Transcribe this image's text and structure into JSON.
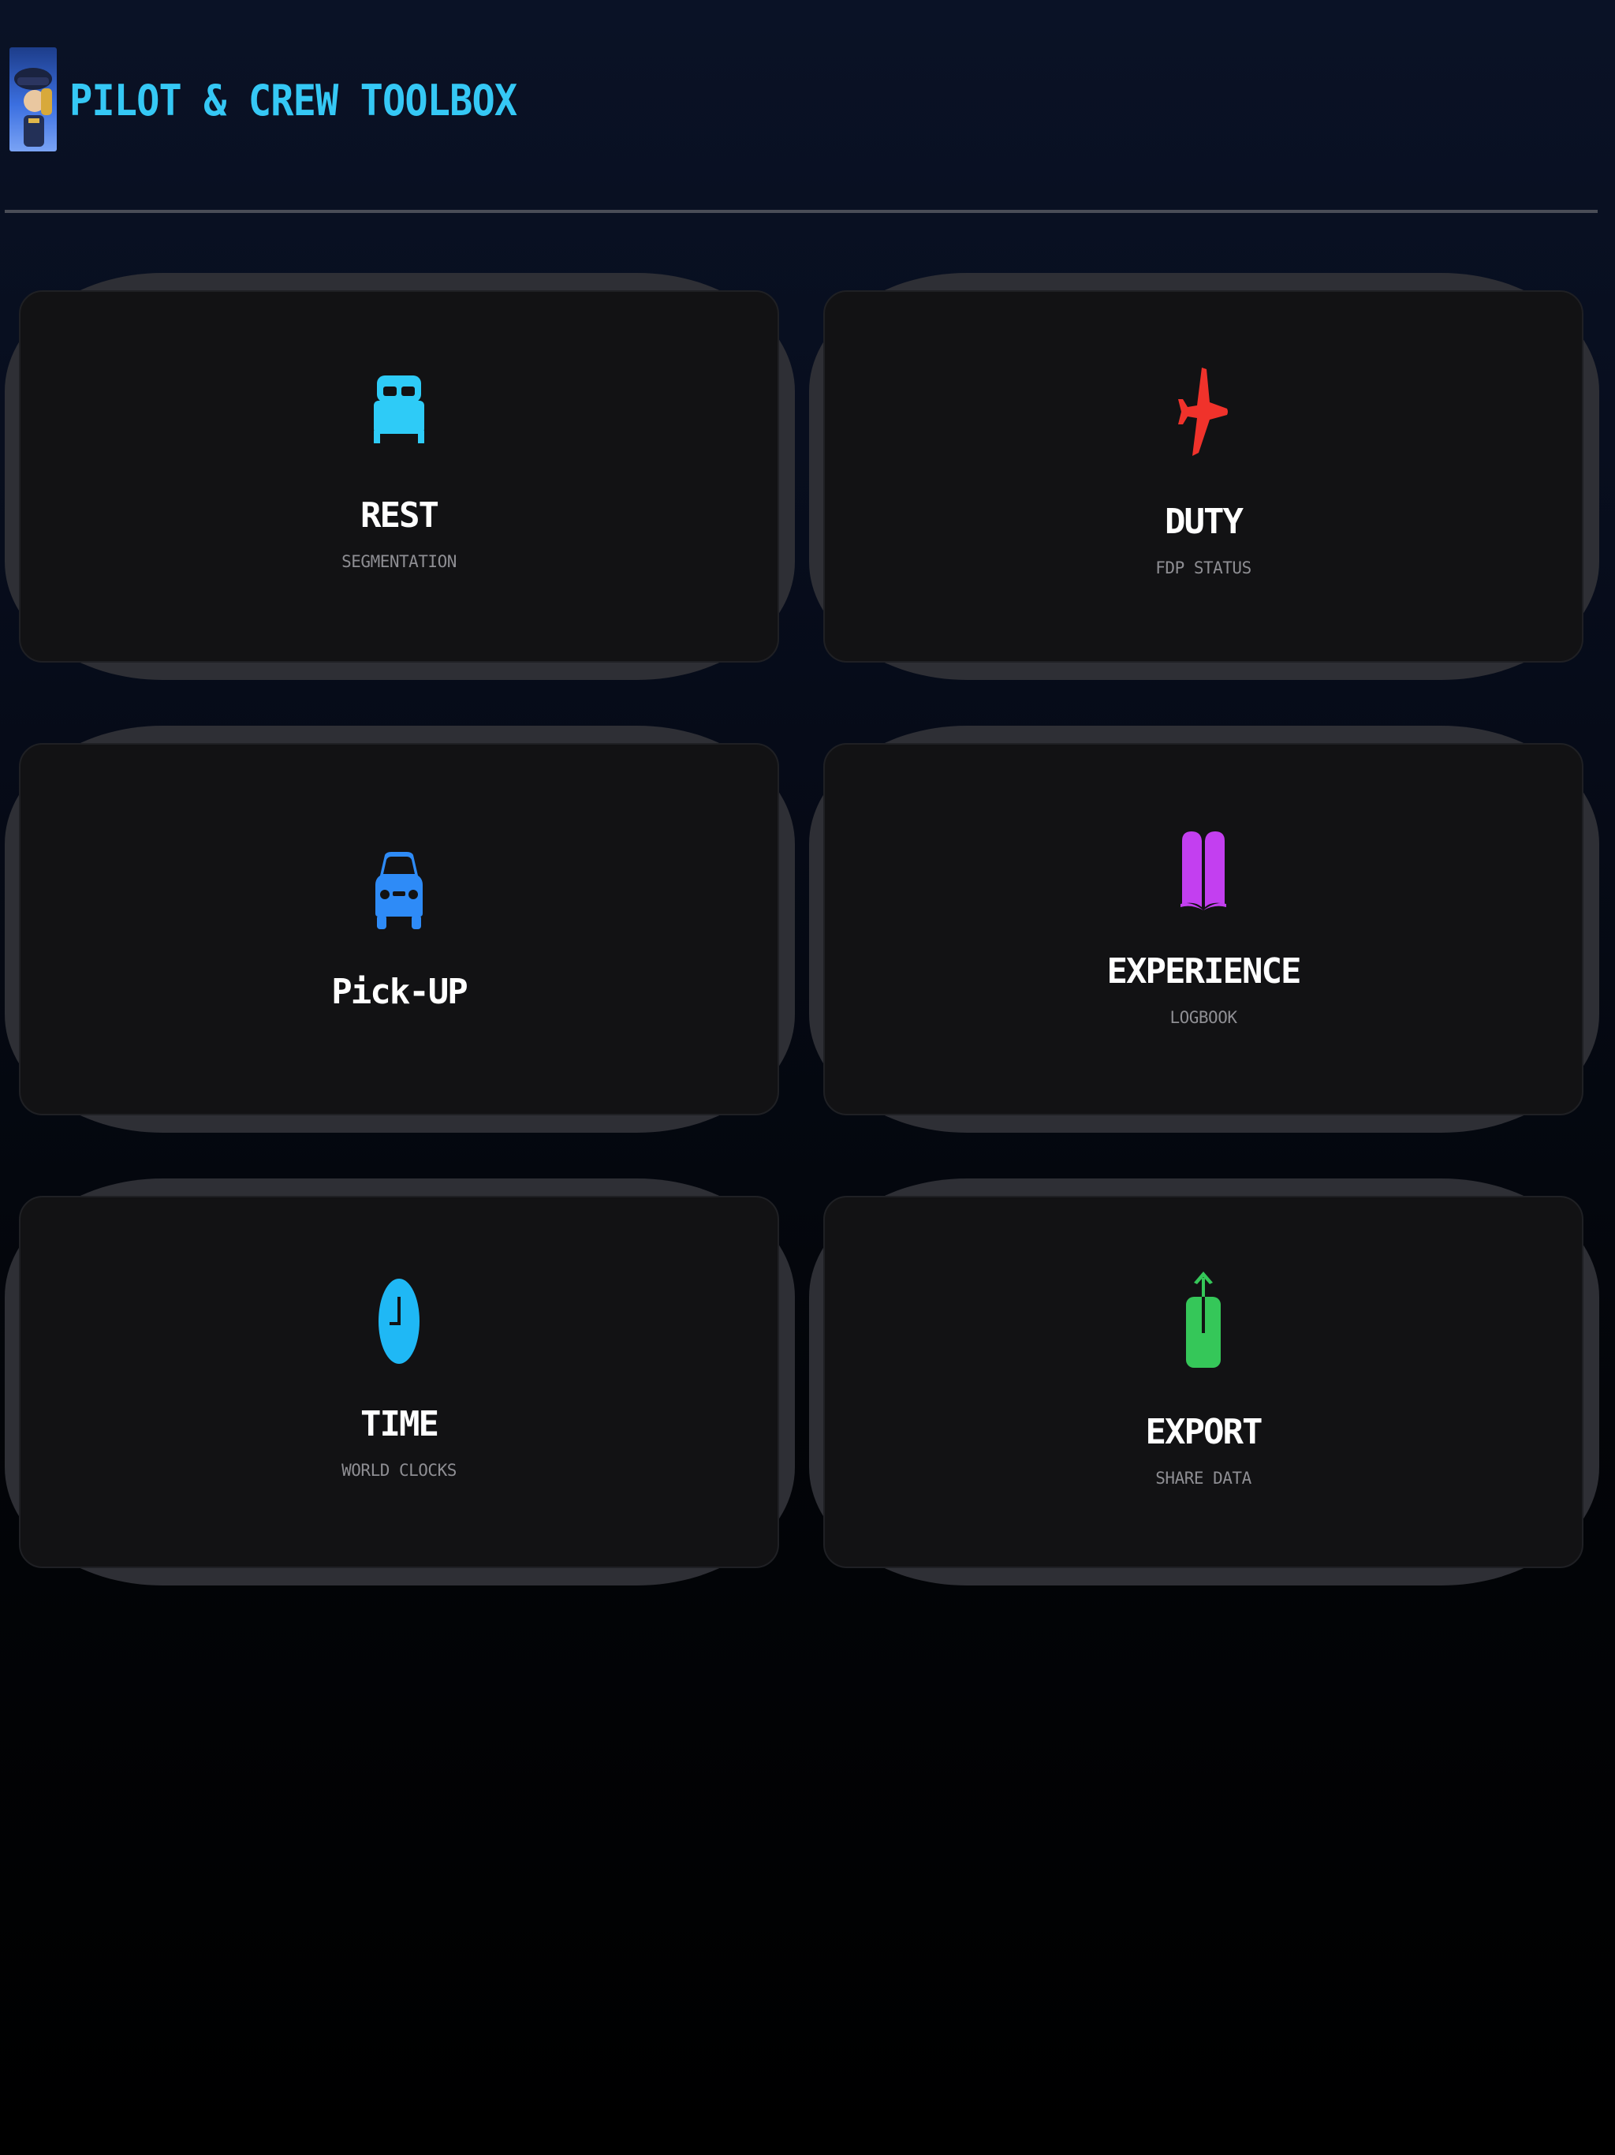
{
  "app": {
    "title": "PILOT & CREW TOOLBOX",
    "logo_icon": "pilot-avatar-icon"
  },
  "colors": {
    "title": "#35c8f5",
    "rest": "#2ecbf7",
    "duty": "#f0322b",
    "pickup": "#2e8bf7",
    "experience": "#c33ff0",
    "time": "#1fb8f5",
    "export": "#35c759"
  },
  "tiles": [
    {
      "id": "rest",
      "label": "REST",
      "sublabel": "SEGMENTATION",
      "icon": "bed-icon"
    },
    {
      "id": "duty",
      "label": "DUTY",
      "sublabel": "FDP STATUS",
      "icon": "airplane-icon"
    },
    {
      "id": "pickup",
      "label": "Pick-UP",
      "sublabel": "",
      "icon": "car-icon"
    },
    {
      "id": "experience",
      "label": "EXPERIENCE",
      "sublabel": "LOGBOOK",
      "icon": "book-icon"
    },
    {
      "id": "time",
      "label": "TIME",
      "sublabel": "WORLD CLOCKS",
      "icon": "clock-icon"
    },
    {
      "id": "export",
      "label": "EXPORT",
      "sublabel": "SHARE DATA",
      "icon": "share-icon"
    }
  ]
}
